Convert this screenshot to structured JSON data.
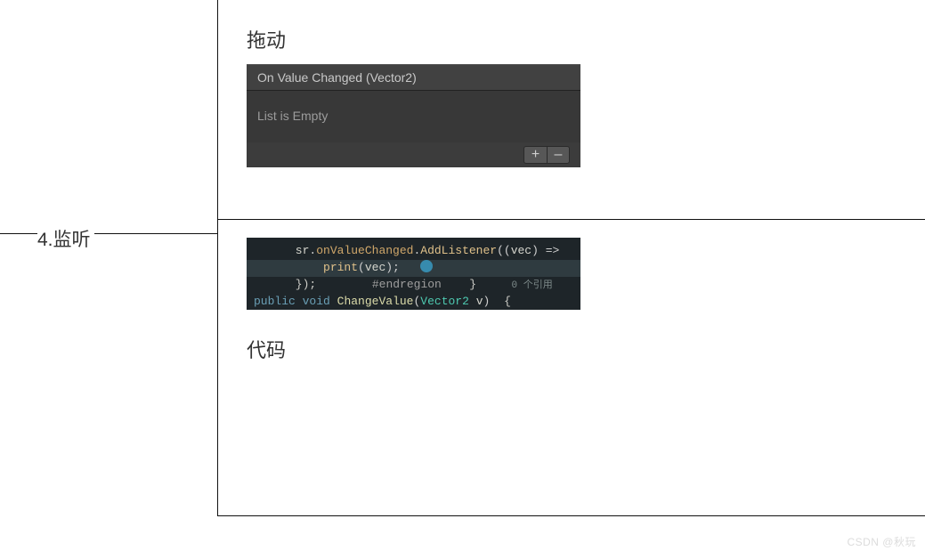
{
  "leftLabel": "4.监听",
  "topCell": {
    "title": "拖动",
    "inspector": {
      "header": "On Value Changed (Vector2)",
      "empty": "List is Empty",
      "plus": "+",
      "minus": "–"
    }
  },
  "bottomCell": {
    "title": "代码",
    "code": {
      "l1_prefix": "      sr",
      "l1_dot1": ".",
      "l1_m1": "onValueChanged",
      "l1_dot2": ".",
      "l1_m2": "AddListener",
      "l1_open": "((",
      "l1_param": "vec",
      "l1_arrow": ") =>",
      "l2": "      {",
      "l3_indent": "          ",
      "l3_fn": "print",
      "l3_open": "(",
      "l3_arg": "vec",
      "l3_close": ");",
      "l4": "      });",
      "l5": "      #endregion",
      "l6": "  }",
      "l7_ref": "0 个引用",
      "l8_pub": "public",
      "l8_sp1": " ",
      "l8_void": "void",
      "l8_sp2": " ",
      "l8_fn": "ChangeValue",
      "l8_open": "(",
      "l8_type": "Vector2",
      "l8_sp3": " ",
      "l8_arg": "v",
      "l8_close": ")",
      "l9": "{"
    }
  },
  "watermark": "CSDN @秋玩"
}
